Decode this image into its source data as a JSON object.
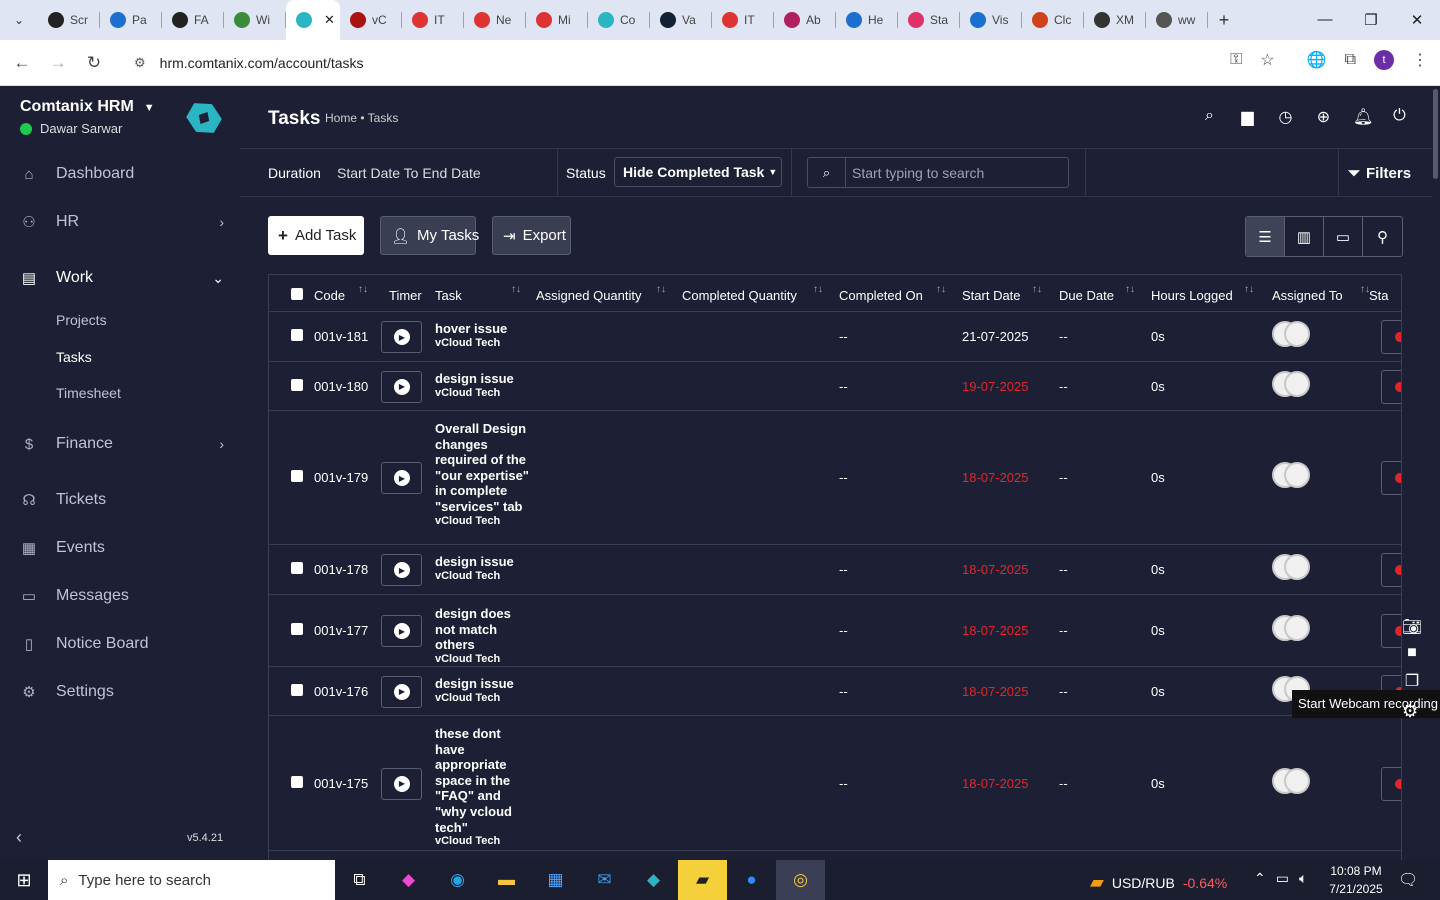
{
  "browser": {
    "tabs": [
      {
        "label": "Scr",
        "color": "#222"
      },
      {
        "label": "Pa",
        "color": "#1a6fd1"
      },
      {
        "label": "FA",
        "color": "#222"
      },
      {
        "label": "Wi",
        "color": "#3a8c3a"
      },
      {
        "label": "",
        "color": "#2bb5c2"
      },
      {
        "label": "vC",
        "color": "#a11"
      },
      {
        "label": "IT",
        "color": "#d33"
      },
      {
        "label": "Ne",
        "color": "#d33"
      },
      {
        "label": "Mi",
        "color": "#d33"
      },
      {
        "label": "Co",
        "color": "#2bb5c2"
      },
      {
        "label": "Va",
        "color": "#123"
      },
      {
        "label": "IT",
        "color": "#d33"
      },
      {
        "label": "Ab",
        "color": "#b02060"
      },
      {
        "label": "He",
        "color": "#1a6fd1"
      },
      {
        "label": "Sta",
        "color": "#e0306a"
      },
      {
        "label": "Vis",
        "color": "#1a6fd1"
      },
      {
        "label": "Clc",
        "color": "#d0421c"
      },
      {
        "label": "XM",
        "color": "#333"
      },
      {
        "label": "ww",
        "color": "#555"
      }
    ],
    "url": "hrm.comtanix.com/account/tasks",
    "profile_initial": "t"
  },
  "sidebar": {
    "brand": "Comtanix HRM",
    "user": "Dawar Sarwar",
    "items": [
      {
        "label": "Dashboard"
      },
      {
        "label": "HR"
      },
      {
        "label": "Work"
      },
      {
        "label": "Finance"
      },
      {
        "label": "Tickets"
      },
      {
        "label": "Events"
      },
      {
        "label": "Messages"
      },
      {
        "label": "Notice Board"
      },
      {
        "label": "Settings"
      }
    ],
    "work_sub": [
      "Projects",
      "Tasks",
      "Timesheet"
    ],
    "version": "v5.4.21"
  },
  "header": {
    "title": "Tasks",
    "breadcrumb": "Home • Tasks"
  },
  "filters": {
    "duration_label": "Duration",
    "duration_value": "Start Date To End Date",
    "status_label": "Status",
    "status_value": "Hide Completed Task",
    "search_placeholder": "Start typing to search",
    "filters_label": "Filters"
  },
  "actions": {
    "add": "Add Task",
    "my": "My Tasks",
    "export": "Export"
  },
  "table": {
    "headers": [
      "Code",
      "Timer",
      "Task",
      "Assigned Quantity",
      "Completed Quantity",
      "Completed On",
      "Start Date",
      "Due Date",
      "Hours Logged",
      "Assigned To",
      "Sta"
    ],
    "rows": [
      {
        "code": "001v-181",
        "task": "hover issue",
        "project": "vCloud Tech",
        "completed_on": "--",
        "start": "21-07-2025",
        "start_overdue": false,
        "due": "--",
        "hours": "0s"
      },
      {
        "code": "001v-180",
        "task": "design issue",
        "project": "vCloud Tech",
        "completed_on": "--",
        "start": "19-07-2025",
        "start_overdue": true,
        "due": "--",
        "hours": "0s"
      },
      {
        "code": "001v-179",
        "task": "Overall Design changes required of the \"our expertise\" in complete \"services\" tab",
        "project": "vCloud Tech",
        "completed_on": "--",
        "start": "18-07-2025",
        "start_overdue": true,
        "due": "--",
        "hours": "0s"
      },
      {
        "code": "001v-178",
        "task": "design issue",
        "project": "vCloud Tech",
        "completed_on": "--",
        "start": "18-07-2025",
        "start_overdue": true,
        "due": "--",
        "hours": "0s"
      },
      {
        "code": "001v-177",
        "task": "design does not match others",
        "project": "vCloud Tech",
        "completed_on": "--",
        "start": "18-07-2025",
        "start_overdue": true,
        "due": "--",
        "hours": "0s"
      },
      {
        "code": "001v-176",
        "task": "design issue",
        "project": "vCloud Tech",
        "completed_on": "--",
        "start": "18-07-2025",
        "start_overdue": true,
        "due": "--",
        "hours": "0s"
      },
      {
        "code": "001v-175",
        "task": "these dont have appropriate space in the \"FAQ\" and \"why vcloud tech\"",
        "project": "vCloud Tech",
        "completed_on": "--",
        "start": "18-07-2025",
        "start_overdue": true,
        "due": "--",
        "hours": "0s"
      }
    ]
  },
  "overlay": {
    "tooltip": "Start Webcam recording"
  },
  "taskbar": {
    "search_placeholder": "Type here to search",
    "ticker_pair": "USD/RUB",
    "ticker_change": "-0.64%",
    "time": "10:08 PM",
    "date": "7/21/2025"
  },
  "colors": {
    "bg": "#1d2034",
    "overdue": "#e0262a",
    "online": "#1dca4f",
    "accent": "#2bb5c2"
  }
}
